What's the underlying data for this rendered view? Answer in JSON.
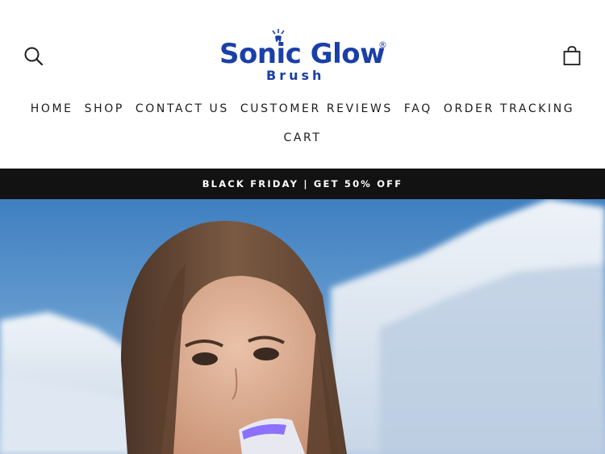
{
  "header": {
    "logo": {
      "name": "Sonic Glow",
      "registered": "®",
      "subtitle": "Brush"
    },
    "icons": {
      "search": "search-icon",
      "cart": "shopping-bag-icon"
    }
  },
  "nav": {
    "items": [
      "HOME",
      "SHOP",
      "CONTACT US",
      "CUSTOMER REVIEWS",
      "FAQ",
      "ORDER TRACKING",
      "CART"
    ]
  },
  "announcement": {
    "text": "BLACK FRIDAY | GET 50% OFF"
  },
  "hero": {
    "image": "woman-using-teeth-whitening-device-in-snowy-mountains"
  },
  "colors": {
    "brand": "#1a3fa8",
    "announcement_bg": "#121212",
    "text": "#1c1d1d"
  }
}
